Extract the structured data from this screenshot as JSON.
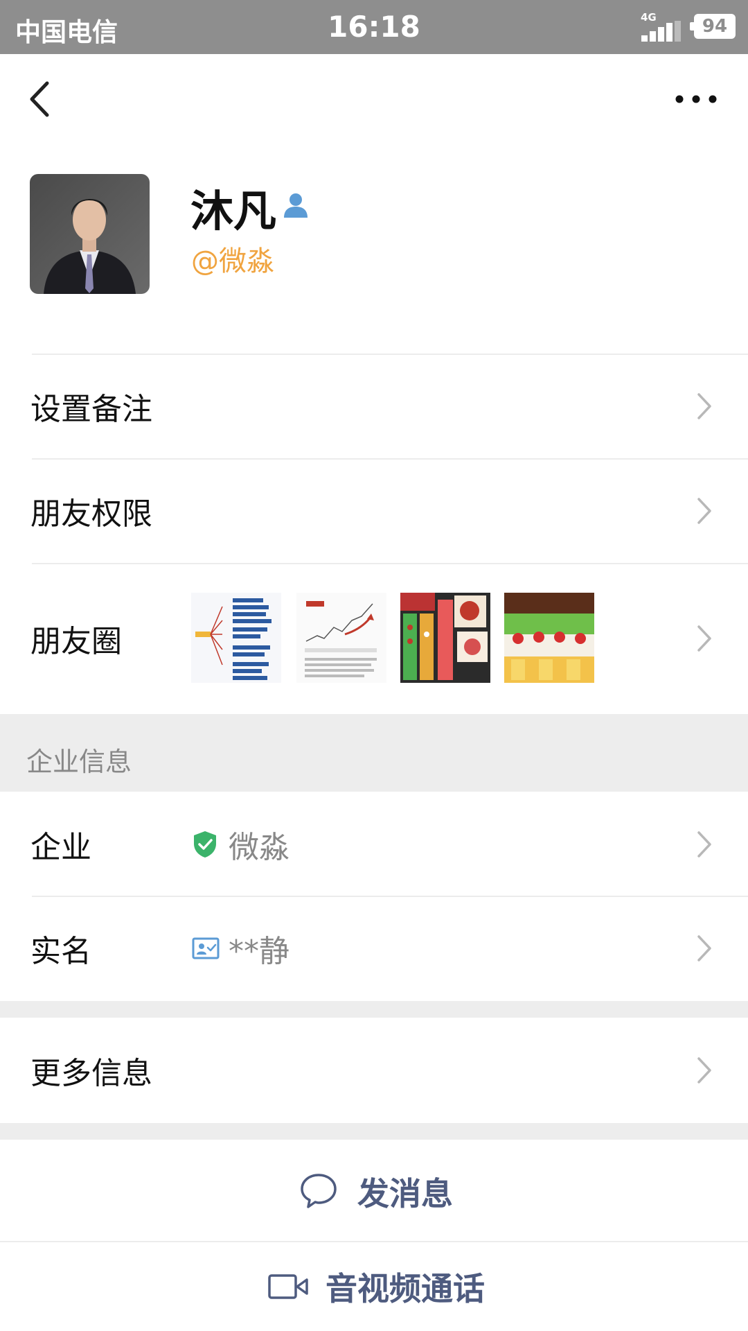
{
  "status_bar": {
    "carrier": "中国电信",
    "time": "16:18",
    "network": "4G",
    "battery": "94"
  },
  "nav": {
    "back_icon": "chevron-left-icon",
    "more_icon": "more-dots-icon"
  },
  "profile": {
    "name": "沐凡",
    "company_handle": "@微淼",
    "badge_icon": "person-icon"
  },
  "rows": {
    "remark": "设置备注",
    "permissions": "朋友权限",
    "moments": "朋友圈"
  },
  "enterprise_section": {
    "title": "企业信息",
    "company_label": "企业",
    "company_value": "微淼",
    "company_icon": "shield-check-icon",
    "realname_label": "实名",
    "realname_value": "**静",
    "realname_icon": "id-card-icon"
  },
  "more_info": {
    "label": "更多信息"
  },
  "actions": {
    "message": "发消息",
    "call": "音视频通话"
  },
  "colors": {
    "status_bar": "#8e8e8e",
    "handle": "#f0a440",
    "action_text": "#4e5b7f",
    "verified_green": "#3bb36a",
    "badge_blue": "#5b9bd5"
  }
}
